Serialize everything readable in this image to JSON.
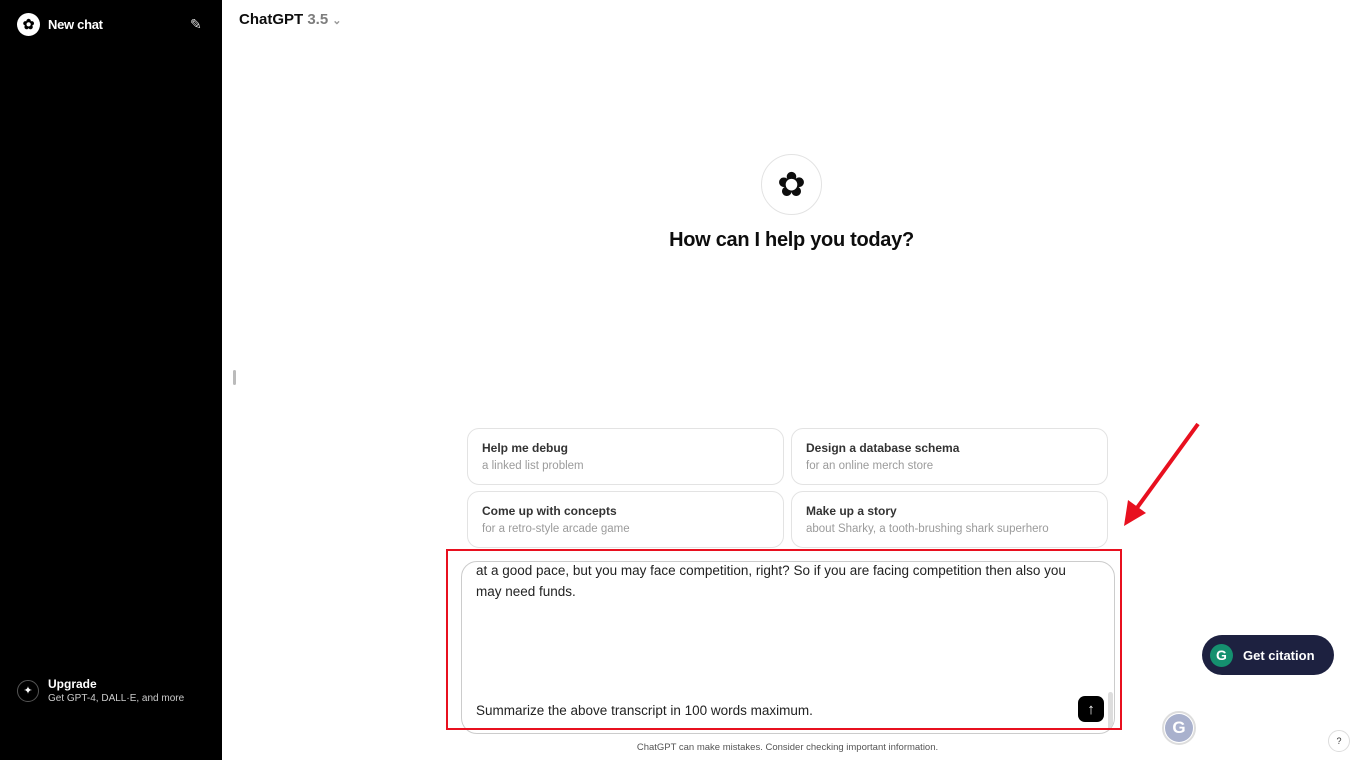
{
  "sidebar": {
    "new_chat": "New chat",
    "upgrade": {
      "title": "Upgrade",
      "subtitle": "Get GPT-4, DALL·E, and more"
    }
  },
  "header": {
    "model": "ChatGPT",
    "version": "3.5"
  },
  "main": {
    "heading": "How can I help you today?",
    "suggestions": [
      {
        "title": "Help me debug",
        "subtitle": "a linked list problem"
      },
      {
        "title": "Design a database schema",
        "subtitle": "for an online merch store"
      },
      {
        "title": "Come up with concepts",
        "subtitle": "for a retro-style arcade game"
      },
      {
        "title": "Make up a story",
        "subtitle": "about Sharky, a tooth-brushing shark superhero"
      }
    ]
  },
  "composer": {
    "text": "at a good pace, but you may face competition, right? So if you are facing competition then also you may need funds.",
    "last_line": "Summarize the above transcript in 100 words maximum."
  },
  "disclaimer": "ChatGPT can make mistakes. Consider checking important information.",
  "extension": {
    "cite_label": "Get citation",
    "help": "?"
  },
  "colors": {
    "annotation": "#e8101f",
    "cite_bg": "#1d2140",
    "grammarly": "#15906f"
  }
}
